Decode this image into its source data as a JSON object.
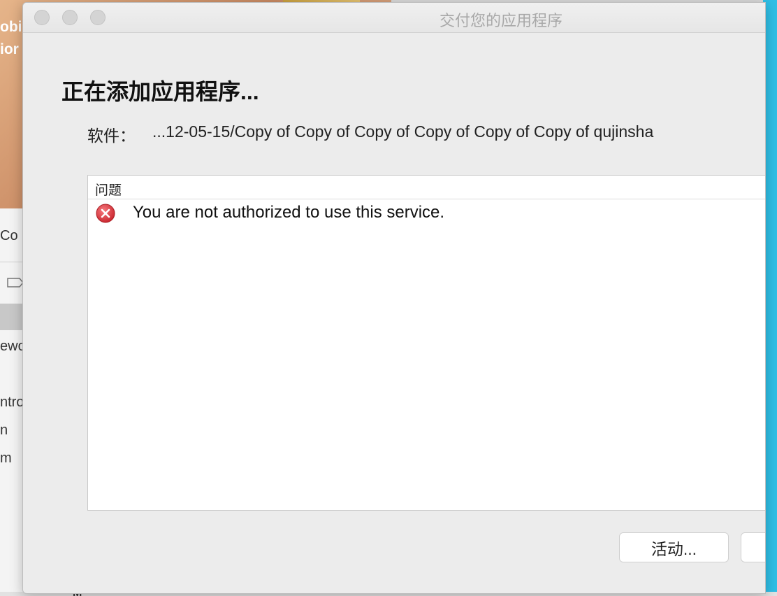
{
  "background": {
    "text_line1": "obi",
    "text_line2": "ior",
    "panel_frag1": "Co",
    "panel_frag2": "ewo",
    "panel_frag3": "ntro",
    "panel_frag4": "n",
    "panel_frag5": "m",
    "bottom_frag": "M",
    "accent_color": "#2fbfe6"
  },
  "window": {
    "title": "交付您的应用程序"
  },
  "main": {
    "heading": "正在添加应用程序...",
    "software_label": "软件：",
    "software_value": "...12-05-15/Copy of Copy of Copy of Copy of Copy of Copy of qujinsha"
  },
  "issues": {
    "column_header": "问题",
    "rows": [
      {
        "icon": "error-icon",
        "message": "You are not authorized to use this service."
      }
    ],
    "error_color": "#d9363e"
  },
  "footer": {
    "activity_button_label": "活动..."
  }
}
